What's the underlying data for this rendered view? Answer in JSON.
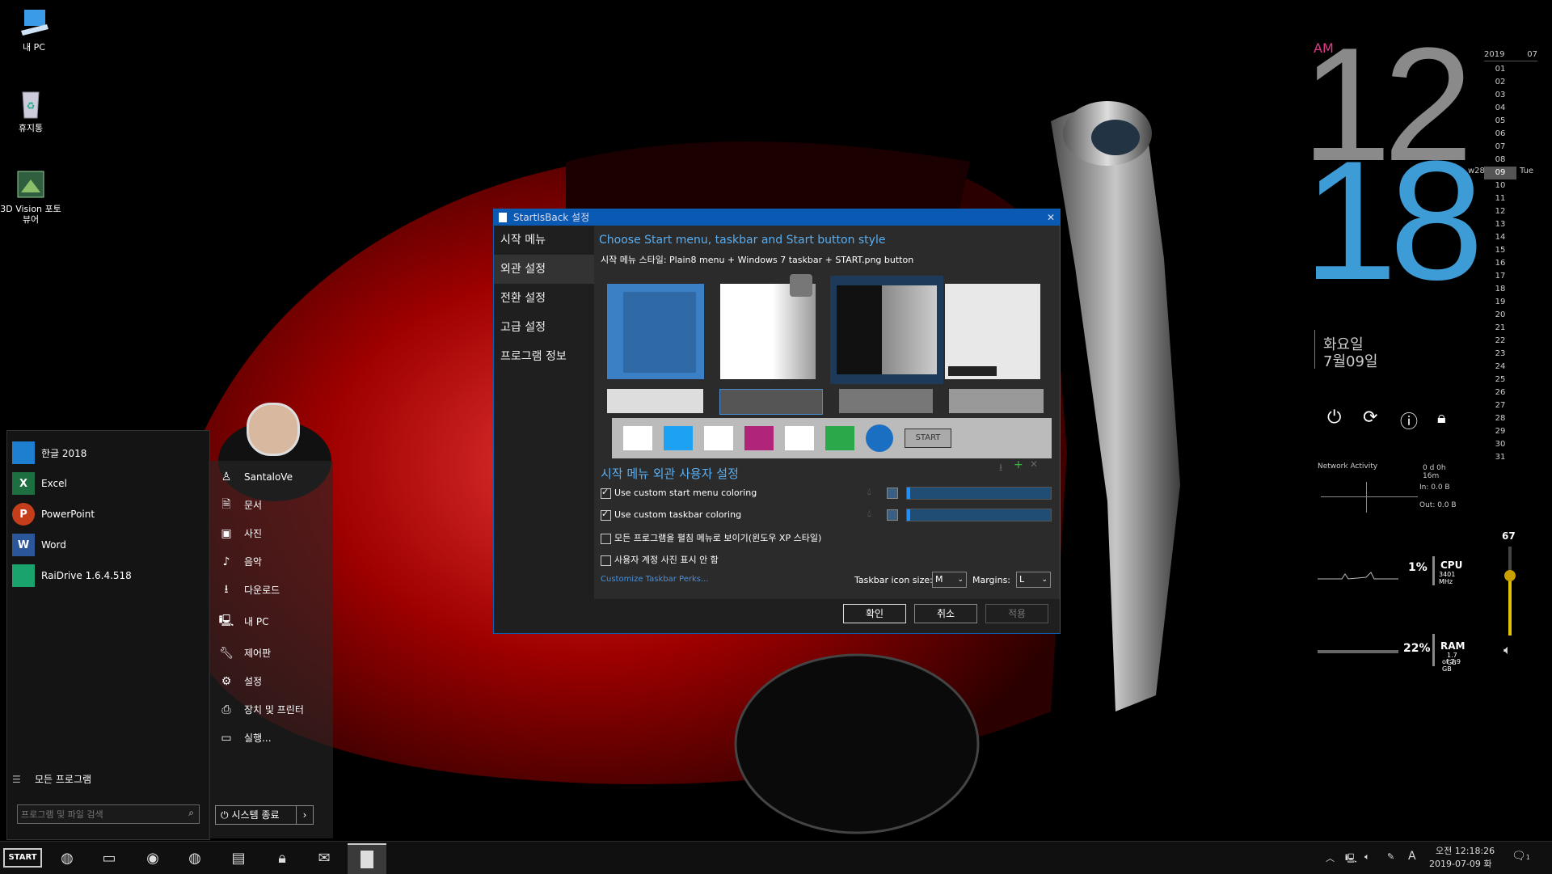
{
  "desktop": {
    "icons": [
      {
        "label": "내 PC"
      },
      {
        "label": "휴지통"
      },
      {
        "label": "3D Vision 포토 뷰어"
      }
    ]
  },
  "clock": {
    "ampm": "AM",
    "hour": "12",
    "minute": "18",
    "weekday": "화요일",
    "date": "7월09일"
  },
  "calendar": {
    "year": "2019",
    "month": "07",
    "week": "w28",
    "today_label": "Tue",
    "days": [
      "01",
      "02",
      "03",
      "04",
      "05",
      "06",
      "07",
      "08",
      "09",
      "10",
      "11",
      "12",
      "13",
      "14",
      "15",
      "16",
      "17",
      "18",
      "19",
      "20",
      "21",
      "22",
      "23",
      "24",
      "25",
      "26",
      "27",
      "28",
      "29",
      "30",
      "31"
    ]
  },
  "network": {
    "title": "Network Activity",
    "uptime": "0 d 0h 16m",
    "in": "In: 0.0 B",
    "out": "Out: 0.0 B"
  },
  "cpu": {
    "percent": "1%",
    "label": "CPU",
    "freq": "3401 MHz"
  },
  "ram": {
    "percent": "22%",
    "label": "RAM",
    "used": "1.7 GB",
    "total": "of 7.9 GB"
  },
  "volume": {
    "value": "67",
    "level": 0.67
  },
  "dialog": {
    "title": "StartIsBack 설정",
    "nav": [
      "시작 메뉴",
      "외관 설정",
      "전환 설정",
      "고급 설정",
      "프로그램 정보"
    ],
    "heading": "Choose Start menu, taskbar and Start button style",
    "style_line": "시작 메뉴 스타일:  Plain8 menu + Windows 7 taskbar + START.png button",
    "section": "시작 메뉴 외관 사용자 설정",
    "options": [
      {
        "label": "Use custom start menu coloring",
        "checked": true
      },
      {
        "label": "Use custom taskbar coloring",
        "checked": true
      },
      {
        "label": "모든 프로그램을 펼침 메뉴로 보이기(윈도우 XP 스타일)",
        "checked": false
      },
      {
        "label": "사용자 계정 사진 표시 안 함",
        "checked": false
      }
    ],
    "perks_link": "Customize Taskbar Perks...",
    "icon_size_label": "Taskbar icon size:",
    "icon_size": "M",
    "margins_label": "Margins:",
    "margins": "L",
    "ok": "확인",
    "cancel": "취소",
    "apply": "적용",
    "start_btn_text": "START"
  },
  "startmenu": {
    "apps": [
      {
        "label": "한글 2018",
        "color": "#1e7fd0",
        "glyph": "ㅎ"
      },
      {
        "label": "Excel",
        "color": "#1d6f42",
        "glyph": "X"
      },
      {
        "label": "PowerPoint",
        "color": "#c43e1c",
        "glyph": "P"
      },
      {
        "label": "Word",
        "color": "#2b579a",
        "glyph": "W"
      },
      {
        "label": "RaiDrive 1.6.4.518",
        "color": "#1aa36d",
        "glyph": ""
      }
    ],
    "all_programs": "모든 프로그램",
    "search_placeholder": "프로그램 및 파일 검색",
    "user": "SantaloVe",
    "right": [
      {
        "label": "문서",
        "icon": "document-icon"
      },
      {
        "label": "사진",
        "icon": "picture-icon"
      },
      {
        "label": "음악",
        "icon": "music-icon"
      },
      {
        "label": "다운로드",
        "icon": "download-icon"
      },
      {
        "label": "내 PC",
        "icon": "computer-icon"
      },
      {
        "label": "제어판",
        "icon": "wrench-icon"
      },
      {
        "label": "설정",
        "icon": "gear-icon"
      },
      {
        "label": "장치 및 프린터",
        "icon": "printer-icon"
      },
      {
        "label": "실행...",
        "icon": "run-icon"
      }
    ],
    "shutdown": "시스템 종료"
  },
  "taskbar": {
    "start": "START",
    "time": "오전 12:18:26",
    "date": "2019-07-09 화",
    "ime": "A",
    "notif_count": "1"
  }
}
